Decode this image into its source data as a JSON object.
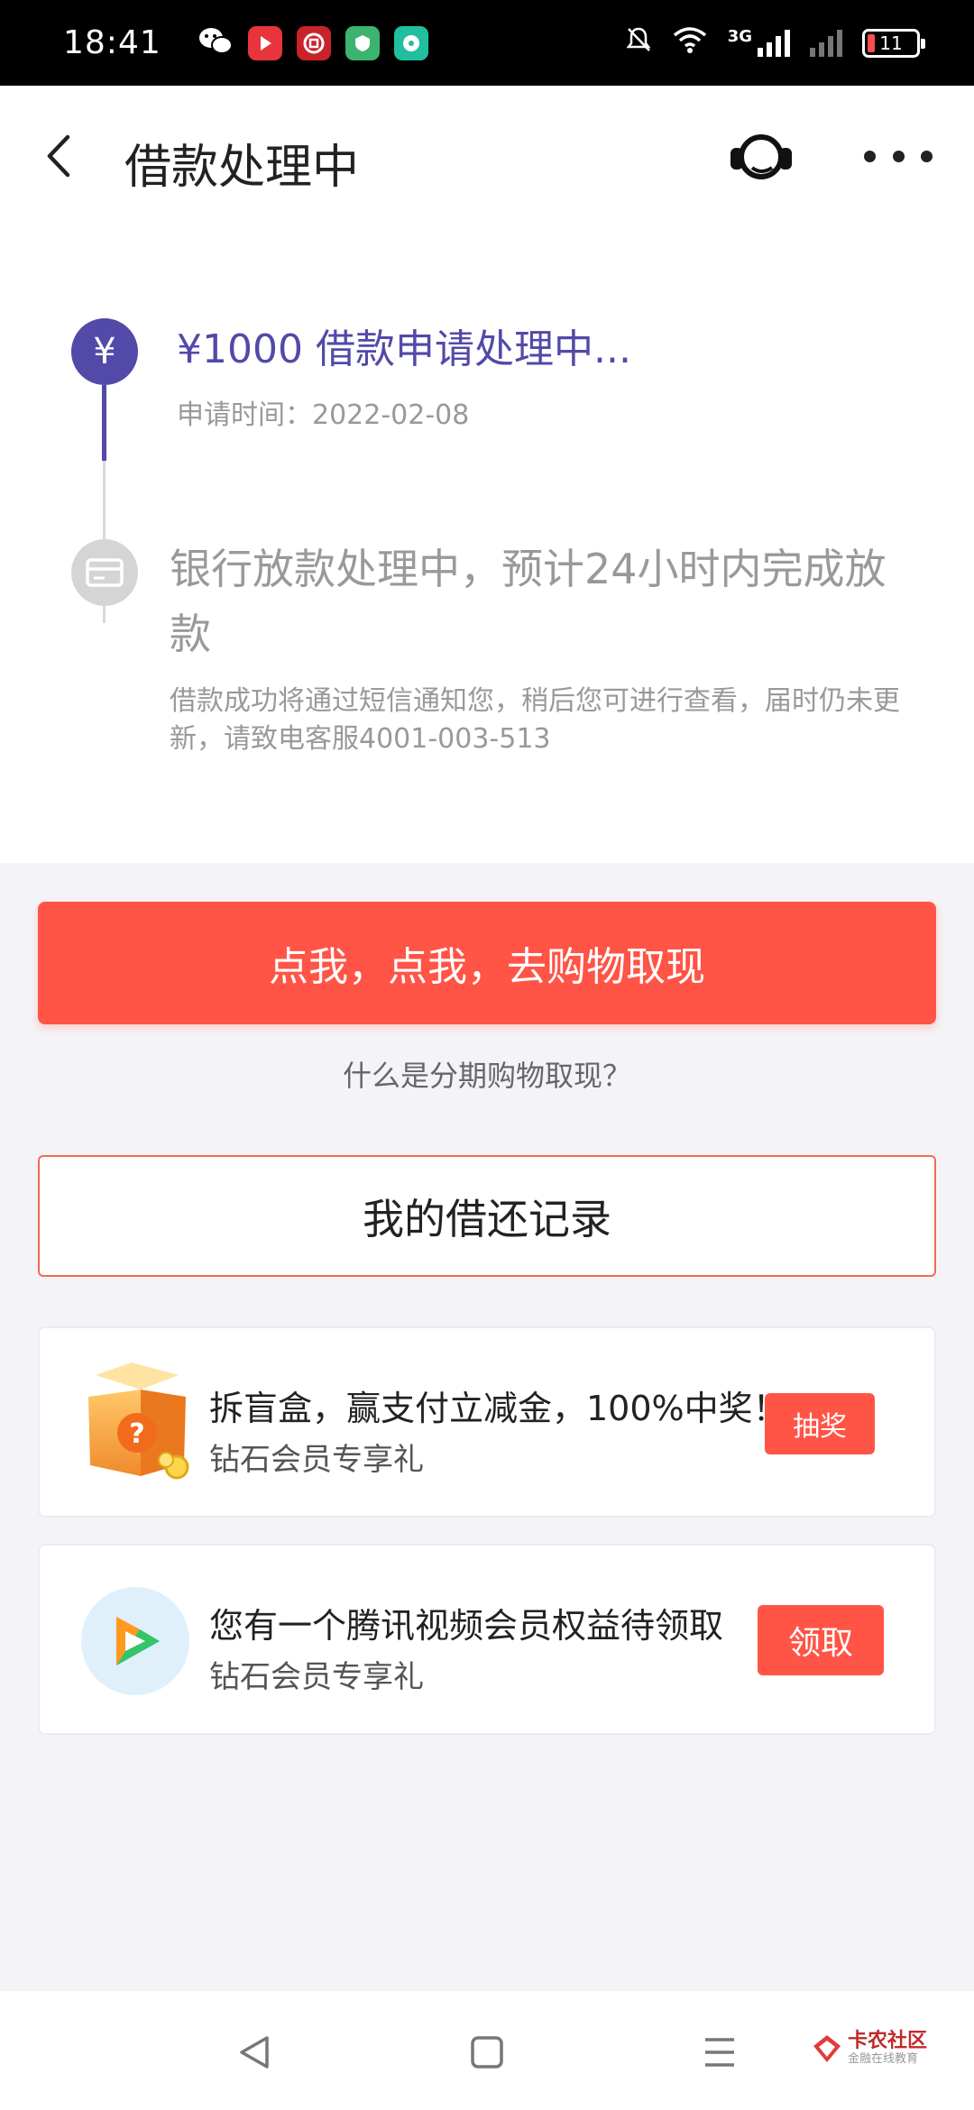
{
  "status_bar": {
    "time": "18:41",
    "network_label": "3G",
    "battery_level": "11"
  },
  "header": {
    "title": "借款处理中"
  },
  "steps": [
    {
      "amount": "¥1000",
      "title": "借款申请处理中...",
      "time_label": "申请时间：",
      "time_value": "2022-02-08",
      "icon_char": "¥"
    },
    {
      "title": "银行放款处理中，预计24小时内完成放款",
      "description": "借款成功将通过短信通知您，稍后您可进行查看，届时仍未更新，请致电客服4001-003-513"
    }
  ],
  "actions": {
    "primary_button": "点我，点我，去购物取现",
    "help_link": "什么是分期购物取现？",
    "record_button": "我的借还记录"
  },
  "promos": [
    {
      "title": "拆盲盒，赢支付立减金，100%中奖！",
      "subtitle": "钻石会员专享礼",
      "button": "抽奖",
      "icon": "mystery-box-icon"
    },
    {
      "title": "您有一个腾讯视频会员权益待领取",
      "subtitle": "钻石会员专享礼",
      "button": "领取",
      "icon": "tencent-video-icon"
    }
  ],
  "watermark": {
    "name": "卡农社区",
    "tagline": "金融在线教育"
  },
  "colors": {
    "accent_purple": "#5249a8",
    "primary_red": "#ff5446",
    "page_bg": "#f4f4f8"
  }
}
